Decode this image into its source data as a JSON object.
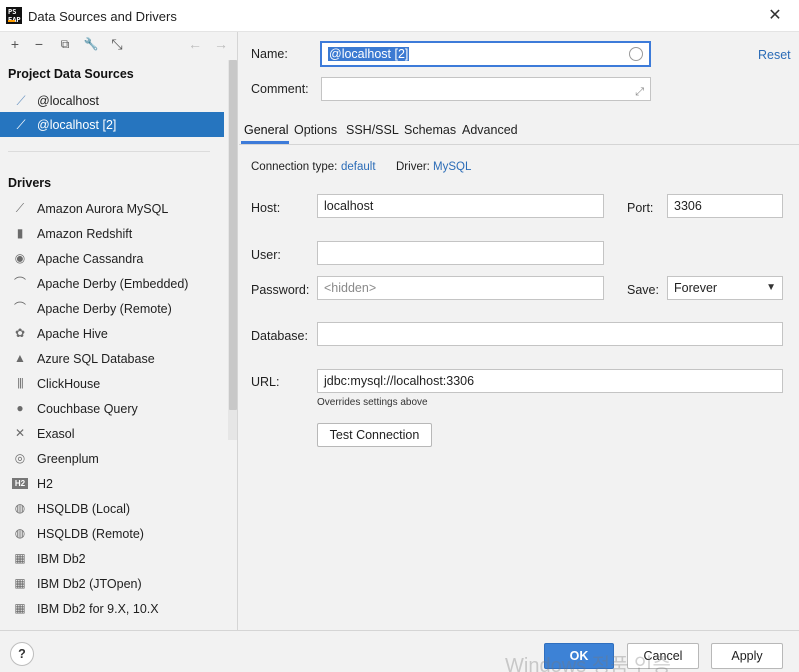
{
  "window": {
    "title": "Data Sources and Drivers",
    "app_icon_text": "PS\nEAP",
    "close_glyph": "✕"
  },
  "toolbar": {
    "add": "+",
    "remove": "−",
    "duplicate": "⧉",
    "properties": "🔧",
    "import": "⤡",
    "back": "←",
    "forward": "→"
  },
  "sidebar": {
    "project_heading": "Project Data Sources",
    "data_sources": [
      {
        "label": "@localhost",
        "icon": "mysql-dolphin-icon"
      },
      {
        "label": "@localhost [2]",
        "icon": "mysql-dolphin-icon"
      }
    ],
    "drivers_heading": "Drivers",
    "drivers": [
      {
        "label": "Amazon Aurora MySQL",
        "icon": "aurora-icon",
        "glyph": "⟋"
      },
      {
        "label": "Amazon Redshift",
        "icon": "redshift-icon",
        "glyph": "▮"
      },
      {
        "label": "Apache Cassandra",
        "icon": "cassandra-icon",
        "glyph": "◉"
      },
      {
        "label": "Apache Derby (Embedded)",
        "icon": "derby-icon",
        "glyph": "⌒"
      },
      {
        "label": "Apache Derby (Remote)",
        "icon": "derby-icon",
        "glyph": "⌒"
      },
      {
        "label": "Apache Hive",
        "icon": "hive-icon",
        "glyph": "✿"
      },
      {
        "label": "Azure SQL Database",
        "icon": "azure-icon",
        "glyph": "▲"
      },
      {
        "label": "ClickHouse",
        "icon": "clickhouse-icon",
        "glyph": "|||"
      },
      {
        "label": "Couchbase Query",
        "icon": "couchbase-icon",
        "glyph": "●"
      },
      {
        "label": "Exasol",
        "icon": "exasol-icon",
        "glyph": "✕"
      },
      {
        "label": "Greenplum",
        "icon": "greenplum-icon",
        "glyph": "◎"
      },
      {
        "label": "H2",
        "icon": "h2-icon",
        "glyph": "H2"
      },
      {
        "label": "HSQLDB (Local)",
        "icon": "hsqldb-icon",
        "glyph": "◍"
      },
      {
        "label": "HSQLDB (Remote)",
        "icon": "hsqldb-icon",
        "glyph": "◍"
      },
      {
        "label": "IBM Db2",
        "icon": "ibm-db2-icon",
        "glyph": "▦"
      },
      {
        "label": "IBM Db2 (JTOpen)",
        "icon": "ibm-db2-icon",
        "glyph": "▦"
      },
      {
        "label": "IBM Db2 for 9.X, 10.X",
        "icon": "ibm-db2-icon",
        "glyph": "▦"
      }
    ]
  },
  "form": {
    "name_label": "Name:",
    "name_value": "@localhost [2]",
    "reset_label": "Reset",
    "comment_label": "Comment:",
    "comment_value": "",
    "tabs": [
      "General",
      "Options",
      "SSH/SSL",
      "Schemas",
      "Advanced"
    ],
    "active_tab": "General",
    "connection_type_label": "Connection type:",
    "connection_type_value": "default",
    "driver_label": "Driver:",
    "driver_value": "MySQL",
    "host_label": "Host:",
    "host_value": "localhost",
    "port_label": "Port:",
    "port_value": "3306",
    "user_label": "User:",
    "user_value": "",
    "password_label": "Password:",
    "password_placeholder": "<hidden>",
    "save_label": "Save:",
    "save_value": "Forever",
    "database_label": "Database:",
    "database_value": "",
    "url_label": "URL:",
    "url_value": "jdbc:mysql://localhost:3306",
    "url_hint": "Overrides settings above",
    "test_connection_label": "Test Connection"
  },
  "footer": {
    "help": "?",
    "ok": "OK",
    "cancel": "Cancel",
    "apply": "Apply",
    "watermark": "Windows 정품 인증"
  },
  "colors": {
    "selection": "#2675bf",
    "accent": "#3d7bd9",
    "link": "#2b6cb7"
  }
}
